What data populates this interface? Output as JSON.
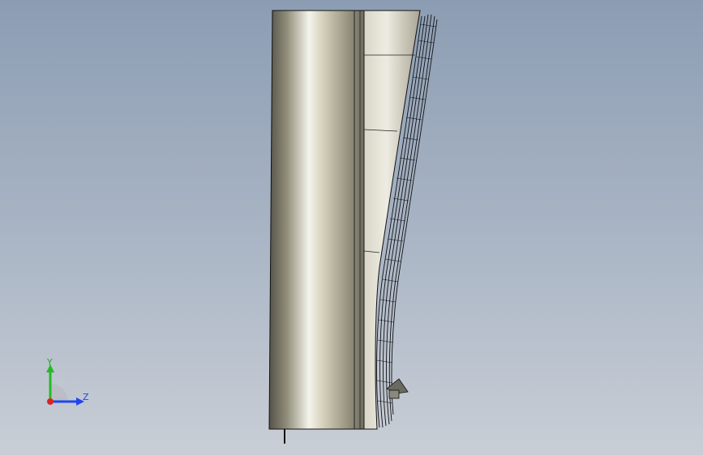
{
  "viewport": {
    "background_top": "#8c9db3",
    "background_bottom": "#c9ced6"
  },
  "model": {
    "body_light": "#f2f0e6",
    "body_mid": "#b9b39f",
    "body_dark": "#4e4b40",
    "edge_color": "#111111"
  },
  "triad": {
    "y_label": "Y",
    "z_label": "Z",
    "y_color": "#22bb22",
    "z_color": "#2244ee",
    "x_color": "#dd2222",
    "icon": "coordinate-triad-icon"
  }
}
